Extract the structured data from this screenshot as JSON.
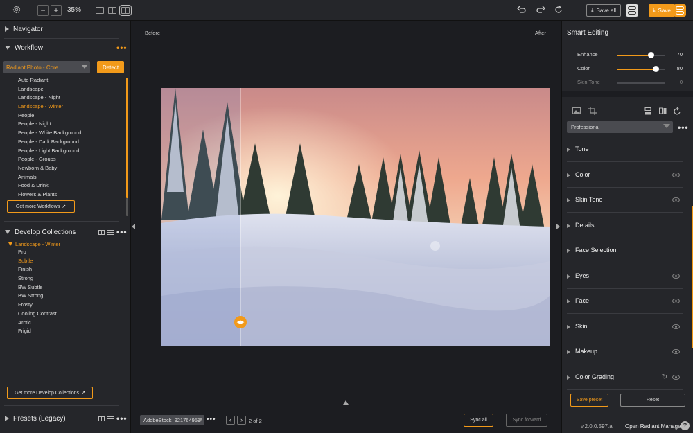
{
  "toolbar": {
    "zoom_out": "−",
    "zoom_in": "+",
    "zoom_level": "35%",
    "save_all_label": "Save all",
    "save_label": "Save",
    "icons": [
      "gear-icon",
      "undo-icon",
      "redo-icon",
      "refresh-icon"
    ]
  },
  "left": {
    "navigator": "Navigator",
    "workflow": "Workflow",
    "workflow_more": "•••",
    "workflow_select": "Radiant Photo - Core",
    "detect": "Detect",
    "workflows": [
      {
        "label": "Auto Radiant",
        "active": false
      },
      {
        "label": "Landscape",
        "active": false
      },
      {
        "label": "Landscape - Night",
        "active": false
      },
      {
        "label": "Landscape - Winter",
        "active": true
      },
      {
        "label": "People",
        "active": false
      },
      {
        "label": "People - Night",
        "active": false
      },
      {
        "label": "People - White Background",
        "active": false
      },
      {
        "label": "People - Dark Background",
        "active": false
      },
      {
        "label": "People - Light Background",
        "active": false
      },
      {
        "label": "People - Groups",
        "active": false
      },
      {
        "label": "Newborn & Baby",
        "active": false
      },
      {
        "label": "Animals",
        "active": false
      },
      {
        "label": "Food & Drink",
        "active": false
      },
      {
        "label": "Flowers & Plants",
        "active": false
      }
    ],
    "get_more_workflows": "Get more Workflows",
    "develop_collections": "Develop Collections",
    "collection_name": "Landscape - Winter",
    "collections": [
      {
        "label": "Pro",
        "active": false
      },
      {
        "label": "Subtle",
        "active": true
      },
      {
        "label": "Finish",
        "active": false
      },
      {
        "label": "Strong",
        "active": false
      },
      {
        "label": "BW Subtle",
        "active": false
      },
      {
        "label": "BW Strong",
        "active": false
      },
      {
        "label": "Frosty",
        "active": false
      },
      {
        "label": "Cooling Contrast",
        "active": false
      },
      {
        "label": "Arctic",
        "active": false
      },
      {
        "label": "Frigid",
        "active": false
      }
    ],
    "get_more_collections": "Get more Develop Collections",
    "presets_legacy": "Presets (Legacy)",
    "more": "•••"
  },
  "center": {
    "before": "Before",
    "after": "After",
    "split_position": 0.204,
    "file_name": "AdobeStock_921764959",
    "page_indicator": "2 of 2",
    "sync_all": "Sync all",
    "sync_forward": "Sync forward",
    "more": "•••"
  },
  "right": {
    "title": "Smart Editing",
    "sliders": [
      {
        "label": "Enhance",
        "value": "70",
        "level": 0.7,
        "disabled": false
      },
      {
        "label": "Color",
        "value": "80",
        "level": 0.8,
        "disabled": false
      },
      {
        "label": "Skin Tone",
        "value": "0",
        "level": 0.0,
        "disabled": true
      }
    ],
    "preset": "Professional",
    "more": "•••",
    "adjustments": [
      {
        "label": "Tone",
        "eye": false,
        "reset": false
      },
      {
        "label": "Color",
        "eye": true,
        "reset": false
      },
      {
        "label": "Skin Tone",
        "eye": true,
        "reset": false
      },
      {
        "label": "Details",
        "eye": false,
        "reset": false
      },
      {
        "label": "Face Selection",
        "eye": false,
        "reset": false
      },
      {
        "label": "Eyes",
        "eye": true,
        "reset": false
      },
      {
        "label": "Face",
        "eye": true,
        "reset": false
      },
      {
        "label": "Skin",
        "eye": true,
        "reset": false
      },
      {
        "label": "Makeup",
        "eye": true,
        "reset": false
      },
      {
        "label": "Color Grading",
        "eye": true,
        "reset": true
      }
    ],
    "save_preset": "Save preset",
    "reset": "Reset",
    "version": "v.2.0.0.597.a",
    "open_manager": "Open Radiant Manager",
    "help": "?"
  },
  "colors": {
    "accent": "#f29a1a",
    "panel": "#25262a",
    "canvas": "#1c1d21"
  }
}
